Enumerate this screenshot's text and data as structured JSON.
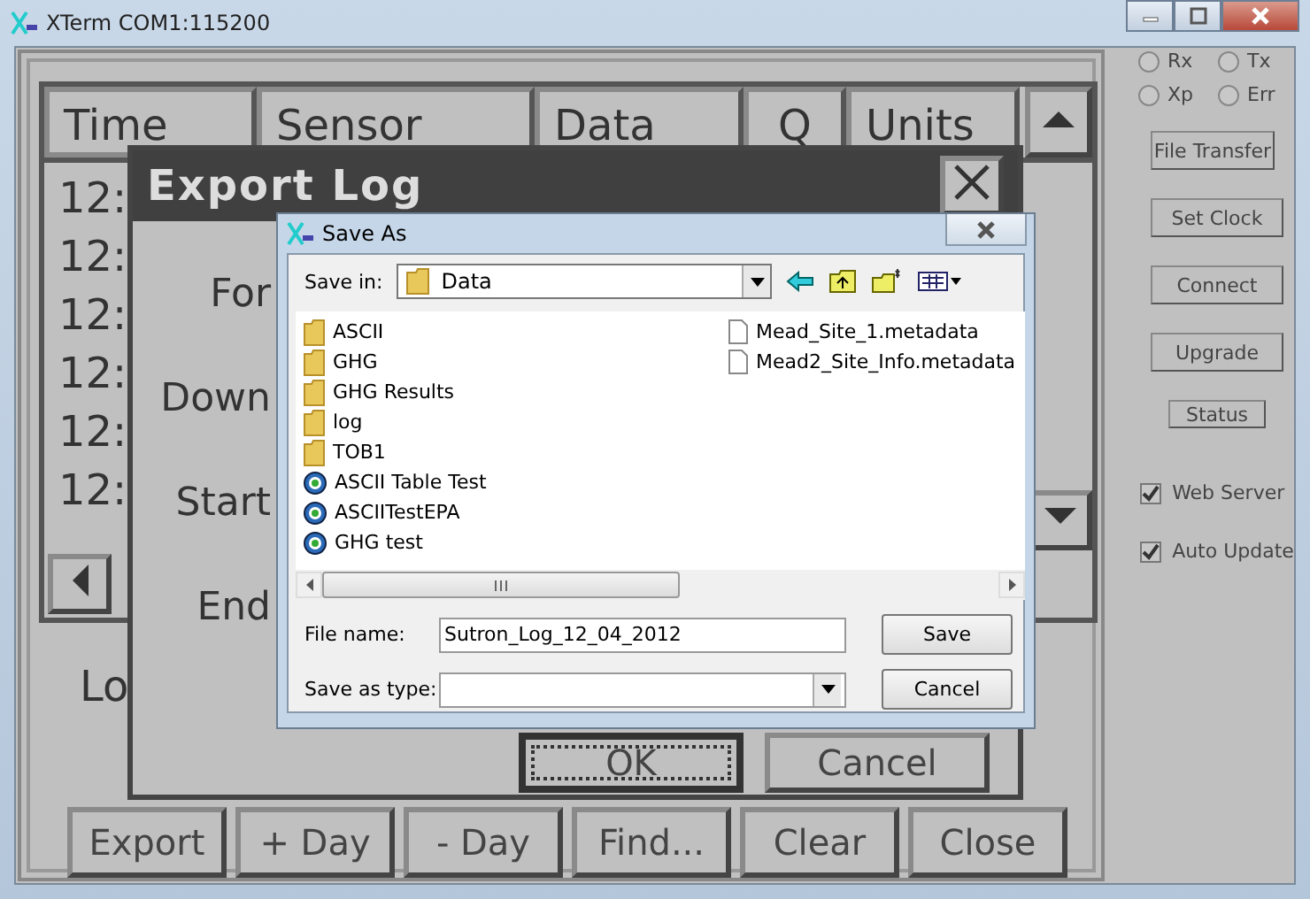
{
  "window": {
    "title": "XTerm COM1:115200"
  },
  "table": {
    "columns": [
      "Time",
      "Sensor",
      "Data",
      "Q",
      "Units"
    ],
    "rows": [
      "12:",
      "12:",
      "12:",
      "12:",
      "12:",
      "12:"
    ]
  },
  "log_label": "Lo",
  "buttons": [
    "Export",
    "+ Day",
    "- Day",
    "Find...",
    "Clear",
    "Close"
  ],
  "indicators": [
    {
      "label": "Rx",
      "on": false
    },
    {
      "label": "Tx",
      "on": false
    },
    {
      "label": "Xp",
      "on": false
    },
    {
      "label": "Err",
      "on": false
    }
  ],
  "side_buttons": [
    "File Transfer",
    "Set Clock",
    "Connect",
    "Upgrade",
    "Status"
  ],
  "options": [
    {
      "label": "Web Server",
      "checked": true
    },
    {
      "label": "Auto Update",
      "checked": true
    }
  ],
  "export_dialog": {
    "title": "Export Log",
    "labels": [
      "For",
      "Down",
      "Start",
      "End"
    ],
    "buttons": [
      "OK",
      "Cancel"
    ]
  },
  "save_dialog": {
    "title": "Save As",
    "save_in_label": "Save in:",
    "save_in": "Data",
    "items": [
      {
        "name": "ASCII",
        "kind": "folder"
      },
      {
        "name": "GHG",
        "kind": "folder"
      },
      {
        "name": "GHG Results",
        "kind": "folder"
      },
      {
        "name": "log",
        "kind": "folder"
      },
      {
        "name": "TOB1",
        "kind": "folder"
      },
      {
        "name": "ASCII Table Test",
        "kind": "app"
      },
      {
        "name": "ASCIITestEPA",
        "kind": "app"
      },
      {
        "name": "GHG test",
        "kind": "app"
      },
      {
        "name": "Mead_Site_1.metadata",
        "kind": "file"
      },
      {
        "name": "Mead2_Site_Info.metadata",
        "kind": "file"
      }
    ],
    "file_name_label": "File name:",
    "file_name": "Sutron_Log_12_04_2012",
    "type_label": "Save as type:",
    "buttons": [
      "Save",
      "Cancel"
    ]
  }
}
